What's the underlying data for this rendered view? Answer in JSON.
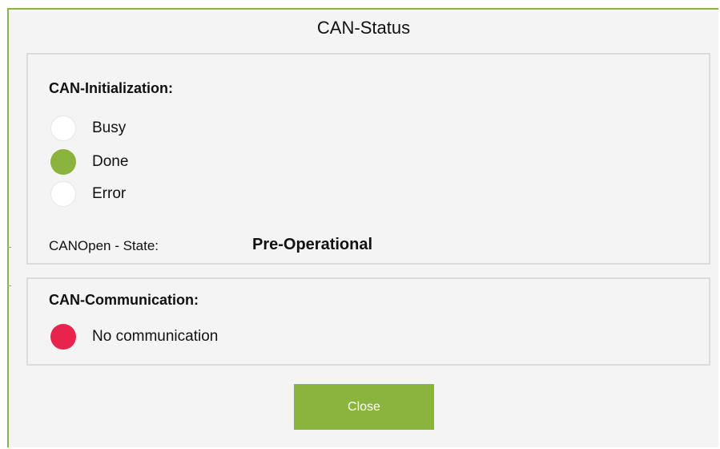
{
  "dialog": {
    "title": "CAN-Status",
    "accent_color": "#8ab43c"
  },
  "initialization": {
    "heading": "CAN-Initialization:",
    "statuses": [
      {
        "label": "Busy",
        "state": "off",
        "color": "#ffffff"
      },
      {
        "label": "Done",
        "state": "on",
        "color": "#8ab43c"
      },
      {
        "label": "Error",
        "state": "off",
        "color": "#ffffff"
      }
    ],
    "canopen_state_label": "CANOpen - State:",
    "canopen_state_value": "Pre-Operational"
  },
  "communication": {
    "heading": "CAN-Communication:",
    "status_label": "No communication",
    "status_color": "#e8234c"
  },
  "actions": {
    "close_label": "Close"
  }
}
